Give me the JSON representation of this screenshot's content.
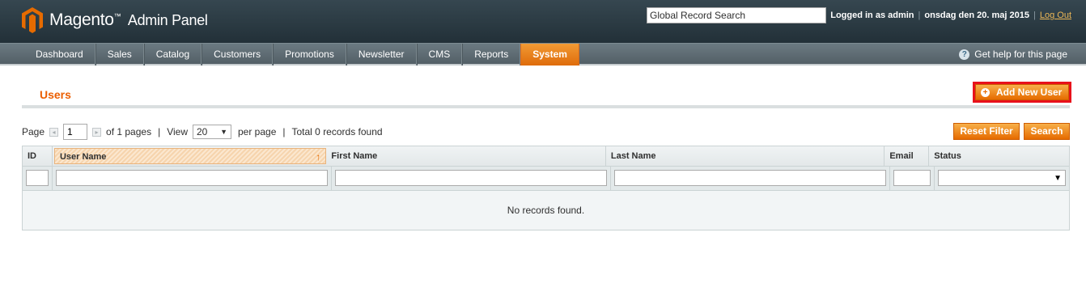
{
  "header": {
    "logo_text": "Magento",
    "logo_tm": "™",
    "logo_suffix": "Admin Panel",
    "search_value": "Global Record Search",
    "logged_in": "Logged in as admin",
    "date": "onsdag den 20. maj 2015",
    "logout": "Log Out",
    "separator": "|"
  },
  "nav": {
    "items": [
      "Dashboard",
      "Sales",
      "Catalog",
      "Customers",
      "Promotions",
      "Newsletter",
      "CMS",
      "Reports",
      "System"
    ],
    "active_index": 8,
    "help": "Get help for this page",
    "help_icon": "?"
  },
  "page": {
    "title": "Users",
    "add_button": "Add New User",
    "plus_icon": "+"
  },
  "pager": {
    "page_label": "Page",
    "page_value": "1",
    "of_pages": "of 1 pages",
    "view_label": "View",
    "per_page_value": "20",
    "per_page_label": "per page",
    "total": "Total 0 records found",
    "pipe": "|",
    "prev_arrow": "◂",
    "next_arrow": "▸",
    "dropdown_arrow": "▼"
  },
  "buttons": {
    "reset_filter": "Reset Filter",
    "search": "Search"
  },
  "grid": {
    "columns": [
      "ID",
      "User Name",
      "First Name",
      "Last Name",
      "Email",
      "Status"
    ],
    "sort_arrow": "↑",
    "status_arrow": "▼",
    "empty": "No records found."
  },
  "colors": {
    "accent": "#eb5e00",
    "button": "#f7931e",
    "highlight_border": "#e8111b",
    "header_bg": "#2a3a43"
  }
}
